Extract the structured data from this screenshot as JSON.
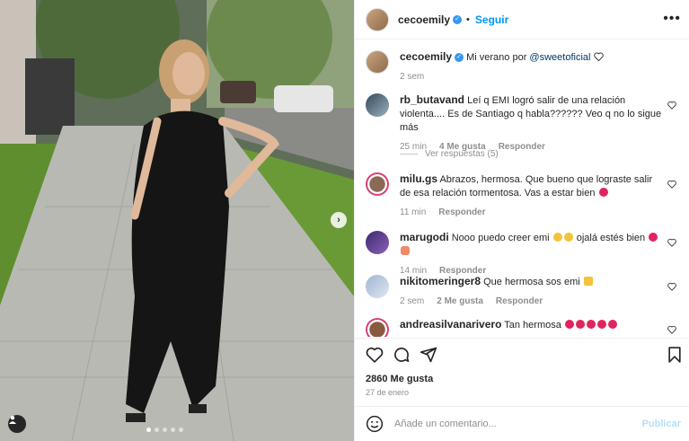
{
  "post": {
    "author": "cecoemily",
    "follow_label": "Seguir",
    "more_icon": "more-horizontal-icon",
    "caption": {
      "text": "Mi verano por ",
      "mention": "@sweetoficial",
      "time": "2 sem"
    }
  },
  "comments": [
    {
      "user": "rb_butavand",
      "text": "Leí q EMI logró salir de una relación violenta.... Es de Santiago q habla?????? Veo q no lo sigue más",
      "time": "25 min",
      "likes": "4 Me gusta",
      "reply": "Responder",
      "replies_label": "Ver respuestas (5)"
    },
    {
      "user": "milu.gs",
      "text": "Abrazos, hermosa. Que bueno que lograste salir de esa relación tormentosa. Vas a estar bien",
      "time": "11 min",
      "reply": "Responder"
    },
    {
      "user": "marugodi",
      "text": "Nooo puedo creer emi",
      "text2": "ojalá estés bien",
      "time": "14 min",
      "reply": "Responder"
    },
    {
      "user": "nikitomeringer8",
      "text": "Que hermosa sos emi",
      "time": "2 sem",
      "likes": "2 Me gusta",
      "reply": "Responder"
    },
    {
      "user": "andreasilvanarivero",
      "text": "Tan hermosa"
    }
  ],
  "stats": {
    "likes": "2860 Me gusta",
    "date": "27 de enero"
  },
  "add_comment": {
    "placeholder": "Añade un comentario...",
    "publish_label": "Publicar"
  },
  "colors": {
    "link": "#0095f6",
    "verified": "#3797f0",
    "heart": "#ed4956"
  }
}
